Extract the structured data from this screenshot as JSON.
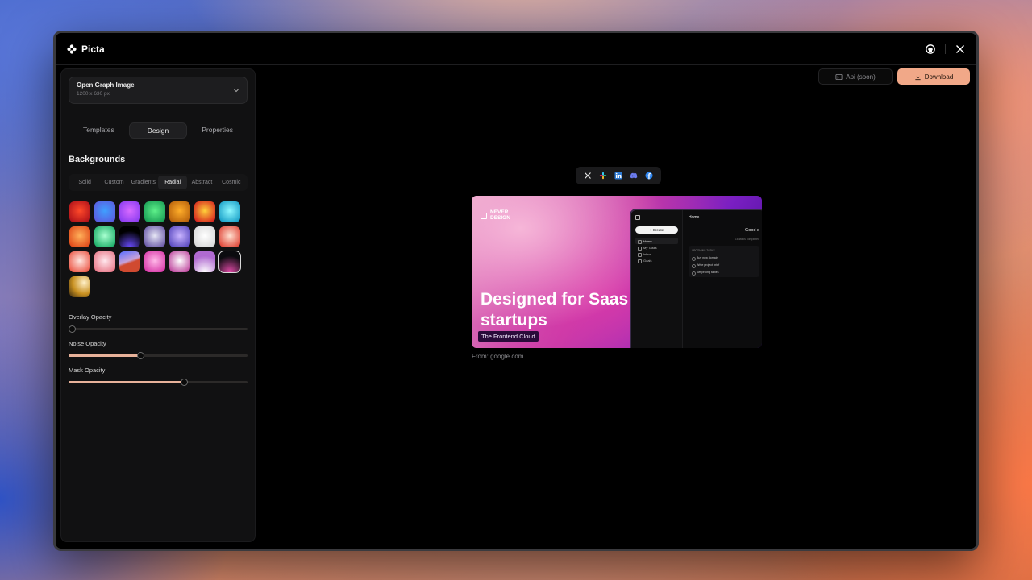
{
  "app": {
    "name": "Picta"
  },
  "topbar": {
    "icons": [
      "github-icon",
      "x-icon"
    ]
  },
  "sidebar": {
    "preset": {
      "name": "Open Graph Image",
      "size": "1200 x 630 px"
    },
    "tabs": [
      {
        "label": "Templates",
        "active": false
      },
      {
        "label": "Design",
        "active": true
      },
      {
        "label": "Properties",
        "active": false
      }
    ],
    "backgrounds_title": "Backgrounds",
    "bg_tabs": [
      {
        "label": "Solid",
        "active": false
      },
      {
        "label": "Custom",
        "active": false
      },
      {
        "label": "Gradients",
        "active": false
      },
      {
        "label": "Radial",
        "active": true
      },
      {
        "label": "Abstract",
        "active": false
      },
      {
        "label": "Cosmic",
        "active": false
      }
    ],
    "swatches": [
      {
        "a": "#ff4a2a",
        "b": "#b0121a",
        "type": "radial"
      },
      {
        "a": "#3fa0ff",
        "b": "#5b5be0",
        "type": "radial"
      },
      {
        "a": "#d86bff",
        "b": "#8a3cf0",
        "type": "radial"
      },
      {
        "a": "#5ef08a",
        "b": "#1a9e55",
        "type": "radial"
      },
      {
        "a": "#ffae2a",
        "b": "#b8620c",
        "type": "radial"
      },
      {
        "a": "#ffd23a",
        "b": "#d6231f",
        "type": "radial"
      },
      {
        "a": "#8ef8ff",
        "b": "#1aa0c8",
        "type": "radial"
      },
      {
        "a": "#ffb05a",
        "b": "#e04a1a",
        "type": "radial"
      },
      {
        "a": "#a8ffd0",
        "b": "#1fb06a",
        "type": "radial"
      },
      {
        "a": "#6a4cff",
        "b": "#000000",
        "type": "bottom"
      },
      {
        "a": "#e6e6f5",
        "b": "#6a5aa8",
        "type": "radial"
      },
      {
        "a": "#c9b4ff",
        "b": "#5a4ac0",
        "type": "radial"
      },
      {
        "a": "#ffffff",
        "b": "#d8d8d8",
        "type": "radial"
      },
      {
        "a": "#ffe0d0",
        "b": "#e0483a",
        "type": "radial"
      },
      {
        "a": "#ffe6e0",
        "b": "#ec5a4a",
        "type": "radial"
      },
      {
        "a": "#ffe8ee",
        "b": "#e87a8a",
        "type": "radial"
      },
      {
        "a": "#5a6fff",
        "b": "#d04a30",
        "type": "split"
      },
      {
        "a": "#ffb8e8",
        "b": "#d83aa9",
        "type": "radial"
      },
      {
        "a": "#ffffff",
        "b": "#c04aa0",
        "type": "radial"
      },
      {
        "a": "#ffffff",
        "b": "#b06ad0",
        "type": "bottom"
      },
      {
        "a": "#e24aa8",
        "b": "#0b0b0f",
        "type": "bottom"
      },
      {
        "a": "#fff0c8",
        "b": "#c89020",
        "type": "corner"
      }
    ],
    "selected_swatch": 20,
    "sliders": [
      {
        "label": "Overlay Opacity",
        "value": 0.02
      },
      {
        "label": "Noise Opacity",
        "value": 0.405
      },
      {
        "label": "Mask Opacity",
        "value": 0.645
      }
    ]
  },
  "actions": {
    "api_label": "Api (soon)",
    "download_label": "Download"
  },
  "social": [
    "x-icon",
    "slack-icon",
    "linkedin-icon",
    "discord-icon",
    "facebook-icon"
  ],
  "preview": {
    "logo_line1": "NEVER",
    "logo_line2": "DESIGN",
    "headline": "Designed for Saas startups",
    "tag": "The Frontend Cloud",
    "from": "From: google.com",
    "mock": {
      "header": "Home",
      "create": "+ Create",
      "nav": [
        "Home",
        "My Tasks",
        "Inbox",
        "Goals"
      ],
      "greeting": "Good e",
      "sub": "16 tasks completed",
      "tasks_label": "UPCOMING TASKS",
      "tasks": [
        "Buy new domain",
        "Write project brief",
        "Set pricing tables"
      ]
    }
  }
}
